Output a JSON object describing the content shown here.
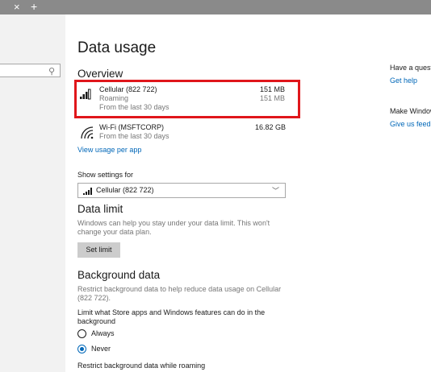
{
  "tabbar": {
    "close_glyph": "×",
    "new_glyph": "+"
  },
  "sidebar": {
    "search_placeholder": ""
  },
  "page": {
    "title": "Data usage"
  },
  "overview": {
    "heading": "Overview",
    "items": [
      {
        "icon": "cellular-signal-icon",
        "name": "Cellular (822 722)",
        "value": "151 MB",
        "sub": "Roaming",
        "sub_value": "151 MB",
        "period": "From the last 30 days"
      },
      {
        "icon": "wifi-icon",
        "name": "Wi-Fi (MSFTCORP)",
        "value": "16.82 GB",
        "period": "From the last 30 days"
      }
    ],
    "view_link": "View usage per app"
  },
  "show_settings": {
    "label": "Show settings for",
    "selected": "Cellular (822 722)"
  },
  "data_limit": {
    "heading": "Data limit",
    "desc_line1": "Windows can help you stay under your data limit. This won't",
    "desc_line2": "change your data plan.",
    "button": "Set limit"
  },
  "background": {
    "heading": "Background data",
    "desc_line1": "Restrict background data to help reduce data usage on Cellular",
    "desc_line2": "(822 722).",
    "limit_line1": "Limit what Store apps and Windows features can do in the",
    "limit_line2": "background",
    "options": [
      {
        "label": "Always",
        "selected": false
      },
      {
        "label": "Never",
        "selected": true
      }
    ],
    "roaming_label": "Restrict background data while roaming"
  },
  "right_panel": {
    "question": "Have a questi",
    "help_link": "Get help",
    "make_windows": "Make Window",
    "feedback_link": "Give us feedb"
  },
  "colors": {
    "accent": "#0067b8",
    "highlight": "#e0161b"
  }
}
